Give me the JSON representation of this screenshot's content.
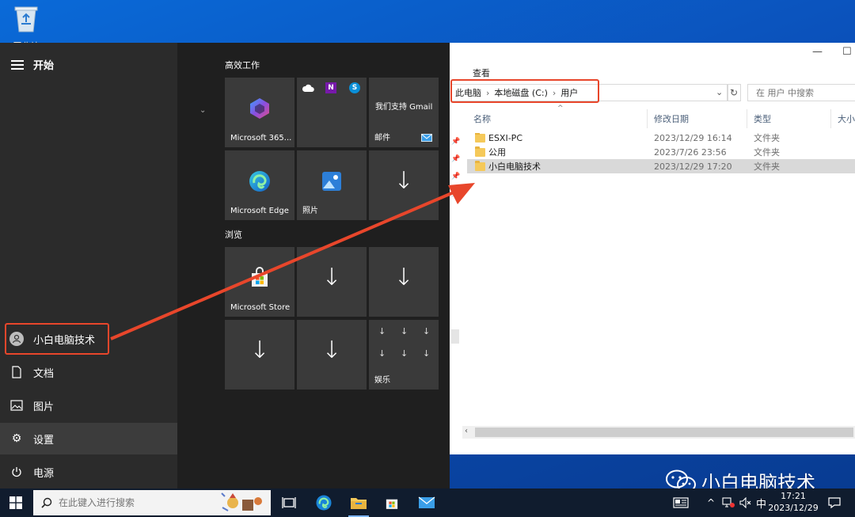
{
  "desktop": {
    "recycle_bin_label": "回收站"
  },
  "explorer": {
    "ribbon_tab": "查看",
    "breadcrumb": [
      "此电脑",
      "本地磁盘 (C:)",
      "用户"
    ],
    "search_placeholder": "在 用户 中搜索",
    "columns": [
      "名称",
      "修改日期",
      "类型",
      "大小"
    ],
    "rows": [
      {
        "name": "ESXI-PC",
        "date": "2023/12/29 16:14",
        "type": "文件夹",
        "selected": false
      },
      {
        "name": "公用",
        "date": "2023/7/26 23:56",
        "type": "文件夹",
        "selected": false
      },
      {
        "name": "小白电脑技术",
        "date": "2023/12/29 17:20",
        "type": "文件夹",
        "selected": true
      }
    ]
  },
  "start_menu": {
    "header": "开始",
    "user": "小白电脑技术",
    "side_items": [
      "文档",
      "图片",
      "设置",
      "电源"
    ],
    "groups": [
      "高效工作",
      "浏览"
    ],
    "tiles": {
      "m365": "Microsoft 365...",
      "gmail_promo": "我们支持 Gmail",
      "mail": "邮件",
      "edge": "Microsoft Edge",
      "photos": "照片",
      "store": "Microsoft Store",
      "entertainment": "娱乐"
    }
  },
  "taskbar": {
    "search_placeholder": "在此键入进行搜索",
    "ime": "中",
    "time": "17:21",
    "date": "2023/12/29"
  },
  "watermark": "小白电脑技术",
  "colors": {
    "annotation_red": "#e8462b",
    "accent": "#0b4fb8"
  }
}
